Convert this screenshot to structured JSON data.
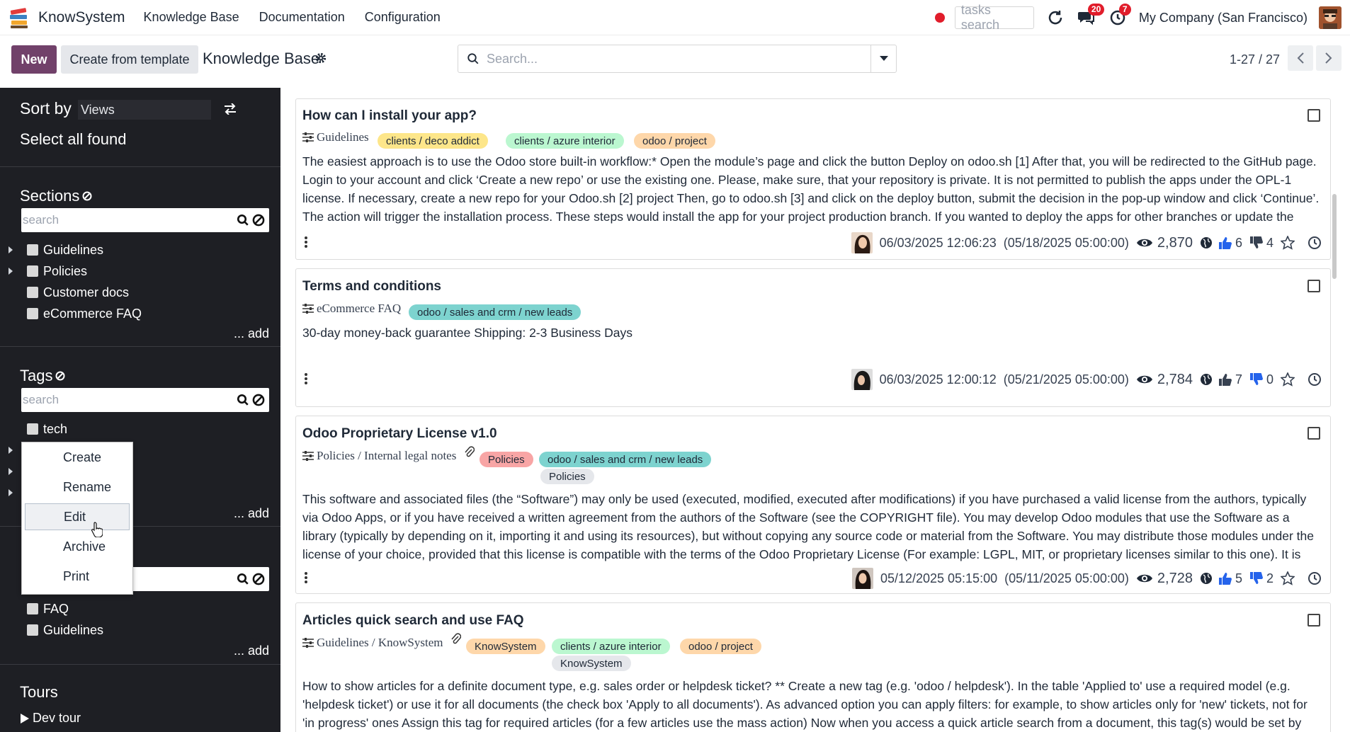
{
  "app": {
    "name": "KnowSystem",
    "menus": [
      "Knowledge Base",
      "Documentation",
      "Configuration"
    ]
  },
  "topbar": {
    "tasks_placeholder": "tasks search",
    "messages_count": "20",
    "activities_count": "7",
    "company": "My Company (San Francisco)"
  },
  "control": {
    "new_label": "New",
    "template_label": "Create from template",
    "title": "Knowledge Base",
    "search_placeholder": "Search...",
    "pager": "1-27 / 27"
  },
  "sidebar": {
    "sort_label": "Sort by",
    "sort_value": "Views",
    "select_all": "Select all found",
    "sections": {
      "title": "Sections",
      "search_placeholder": "search",
      "items": [
        "Guidelines",
        "Policies",
        "Customer docs",
        "eCommerce FAQ"
      ],
      "add": "... add"
    },
    "tags": {
      "title": "Tags",
      "search_placeholder": "search",
      "items": [
        "tech"
      ],
      "add": "... add"
    },
    "types": {
      "items": [
        "FAQ",
        "Guidelines"
      ],
      "add": "... add"
    },
    "tours": {
      "title": "Tours",
      "items": [
        "Dev tour"
      ]
    }
  },
  "context_menu": {
    "items": [
      "Create",
      "Rename",
      "Edit",
      "Archive",
      "Print"
    ],
    "selected": "Edit"
  },
  "articles": [
    {
      "title": "How can I install your app?",
      "section": "Guidelines",
      "tags": [
        "clients / deco addict",
        "clients / azure interior",
        "odoo / project"
      ],
      "text": "The easiest approach is to use the Odoo store built-in workflow:* Open the module’s page and click the button Deploy on odoo.sh [1] After that, you will be redirected to the GitHub page. Login to your account and click ‘Create a new repo’ or use the existing one. Please, make sure, that your repository is private. It is not permitted to publish the apps under the OPL-1 license. If necessary, create a new repo for your Odoo.sh [2] project Then, go to odoo.sh [3] and click on the deploy button, submit the decision in the pop-up window and click ‘Continue’. The action will trigger the installation process. These steps would install the app for your project production branch. If you wanted to deploy the apps for other branches or update the",
      "date": "06/03/2025 12:06:23",
      "review": "(05/18/2025 05:00:00)",
      "views": "2,870",
      "likes": "6",
      "dislikes": "4"
    },
    {
      "title": "Terms and conditions",
      "section": "eCommerce FAQ",
      "tags": [
        "odoo / sales and crm / new leads"
      ],
      "text": "30-day money-back guarantee Shipping: 2-3 Business Days",
      "date": "06/03/2025 12:00:12",
      "review": "(05/21/2025 05:00:00)",
      "views": "2,784",
      "likes": "7",
      "dislikes": "0"
    },
    {
      "title": "Odoo Proprietary License v1.0",
      "section": "Policies / Internal legal notes",
      "tags": [
        "Policies",
        "odoo / sales and crm / new leads"
      ],
      "subtag": "Policies",
      "text": "This software and associated files (the “Software”) may only be used (executed, modified, executed after modifications) if you have purchased a valid license from the authors, typically via Odoo Apps, or if you have received a written agreement from the authors of the Software (see the COPYRIGHT file). You may develop Odoo modules that use the Software as a library (typically by depending on it, importing it and using its resources), but without copying any source code or material from the Software. You may distribute those modules under the license of your choice, provided that this license is compatible with the terms of the Odoo Proprietary License (For example: LGPL, MIT, or proprietary licenses similar to this one). It is forbidden to",
      "date": "05/12/2025 05:15:00",
      "review": "(05/11/2025 05:00:00)",
      "views": "2,728",
      "likes": "5",
      "dislikes": "2"
    },
    {
      "title": "Articles quick search and use FAQ",
      "section": "Guidelines / KnowSystem",
      "tags": [
        "KnowSystem",
        "clients / azure interior",
        "odoo / project"
      ],
      "subtag": "KnowSystem",
      "text": "How to show articles for a definite document type, e.g. sales order or helpdesk ticket? ** Create a new tag (e.g. 'odoo / helpdesk'). In the table 'Applied to' use a required model (e.g. 'helpdesk ticket') or use it for all documents (the check box 'Apply to all documents'). As advanced option you can apply filters: for example, to show articles only for 'new' tickets, not for 'in progress' ones Assign this tag for required articles (for a few articles use the mass action) Now when you access a quick article search from a document, this tag(s) would be set by default, and articles search is limited by this document type / domain How to add an article in Odoo message? ** Turn on the setting 'Articles in Email Composers' Create a new msg (e.g."
    }
  ],
  "colors": {
    "primary": "#71416a",
    "sidebar_bg": "#1e1f24",
    "tag_yellow": "#fde68a",
    "tag_green": "#bbf7d0",
    "tag_orange": "#fed7aa",
    "tag_teal": "#7dd3cf",
    "tag_red": "#f8a5a5",
    "tag_gray": "#e5e7eb",
    "like_blue": "#2563eb"
  }
}
